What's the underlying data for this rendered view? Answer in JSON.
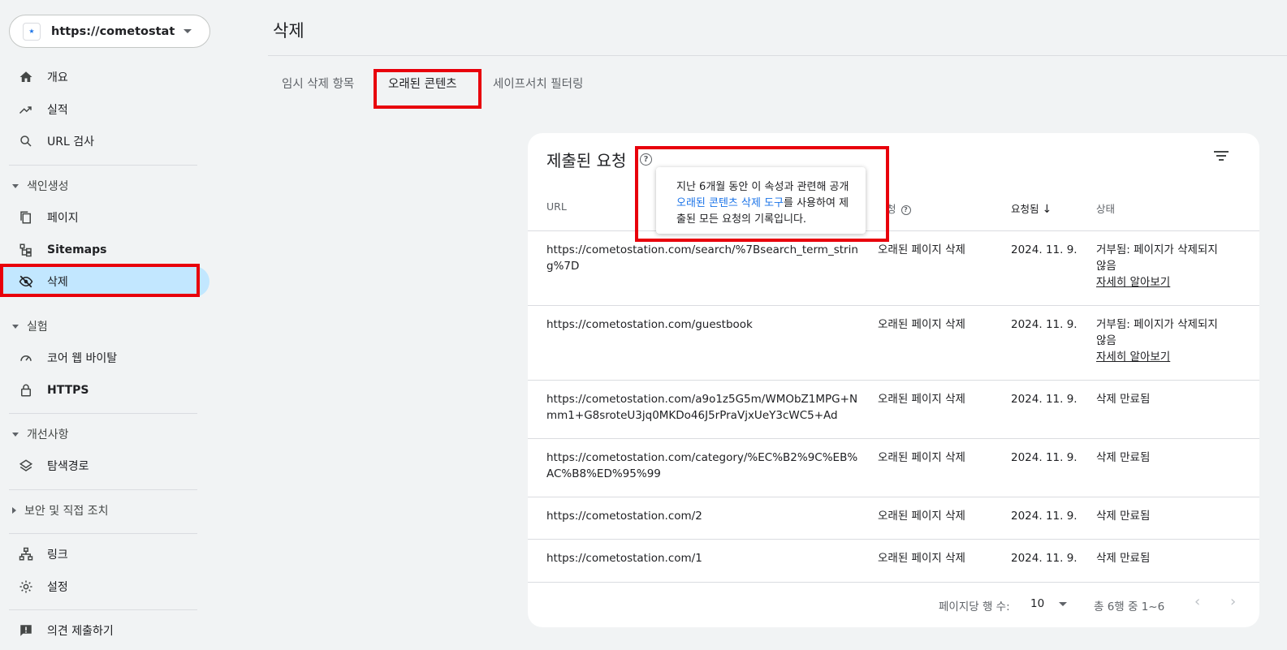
{
  "property": {
    "url": "https://cometostatio..."
  },
  "sidebar": {
    "overview": "개요",
    "performance": "실적",
    "url_inspection": "URL 검사",
    "section_indexing": "색인생성",
    "pages": "페이지",
    "sitemaps": "Sitemaps",
    "removals": "삭제",
    "section_experience": "실험",
    "cwv": "코어 웹 바이탈",
    "https": "HTTPS",
    "section_enhancements": "개선사항",
    "breadcrumbs": "탐색경로",
    "section_security": "보안 및 직접 조치",
    "links": "링크",
    "settings": "설정",
    "feedback": "의견 제출하기"
  },
  "page": {
    "title": "삭제"
  },
  "tabs": [
    "임시 삭제 항목",
    "오래된 콘텐츠",
    "세이프서치 필터링"
  ],
  "card": {
    "title": "제출된 요청",
    "columns": {
      "url": "URL",
      "type_partial": "청",
      "requested": "요청됨",
      "status": "상태"
    },
    "rows": [
      {
        "url": "https://cometostation.com/search/%7Bsearch_term_string%7D",
        "type": "오래된 페이지 삭제",
        "date": "2024. 11. 9.",
        "status": "거부됨: 페이지가 삭제되지 않음",
        "link": "자세히 알아보기"
      },
      {
        "url": "https://cometostation.com/guestbook",
        "type": "오래된 페이지 삭제",
        "date": "2024. 11. 9.",
        "status": "거부됨: 페이지가 삭제되지 않음",
        "link": "자세히 알아보기"
      },
      {
        "url": "https://cometostation.com/a9o1z5G5m/WMObZ1MPG+Nmm1+G8sroteU3jq0MKDo46J5rPraVjxUeY3cWC5+Ad",
        "type": "오래된 페이지 삭제",
        "date": "2024. 11. 9.",
        "status": "삭제 만료됨",
        "link": ""
      },
      {
        "url": "https://cometostation.com/category/%EC%B2%9C%EB%AC%B8%ED%95%99",
        "type": "오래된 페이지 삭제",
        "date": "2024. 11. 9.",
        "status": "삭제 만료됨",
        "link": ""
      },
      {
        "url": "https://cometostation.com/2",
        "type": "오래된 페이지 삭제",
        "date": "2024. 11. 9.",
        "status": "삭제 만료됨",
        "link": ""
      },
      {
        "url": "https://cometostation.com/1",
        "type": "오래된 페이지 삭제",
        "date": "2024. 11. 9.",
        "status": "삭제 만료됨",
        "link": ""
      }
    ],
    "footer": {
      "rows_per_page_label": "페이지당 행 수:",
      "rows_per_page": "10",
      "range": "총 6행 중 1~6"
    }
  },
  "tooltip": {
    "part1": "지난 6개월 동안 이 속성과 관련해 공개 ",
    "link": "오래된 콘텐츠 삭제 도구",
    "part2": "를 사용하여 제출된 모든 요청의 기록입니다."
  },
  "colors": {
    "accent": "#1a73e8",
    "highlight": "#e8000b",
    "active_nav": "#c2e7ff"
  }
}
